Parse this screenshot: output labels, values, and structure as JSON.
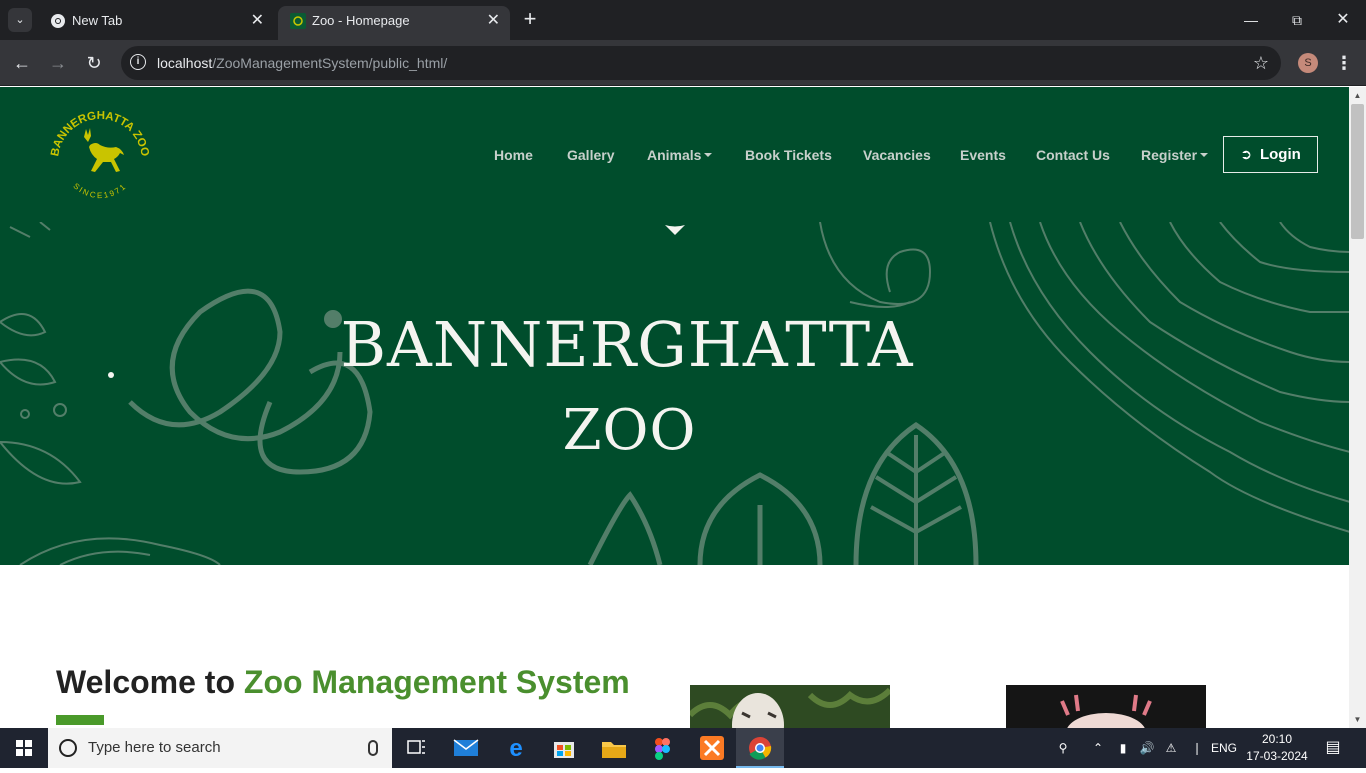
{
  "browser": {
    "tabs": [
      {
        "title": "New Tab",
        "active": false
      },
      {
        "title": "Zoo - Homepage",
        "active": true
      }
    ],
    "url_host": "localhost",
    "url_path": "/ZooManagementSystem/public_html/",
    "profile_initial": "S"
  },
  "site": {
    "logo_text": "BANNERGHATTA ZOO",
    "logo_since": "SINCE1971",
    "nav": [
      "Home",
      "Gallery",
      "Animals",
      "Book Tickets",
      "Vacancies",
      "Events",
      "Contact Us",
      "Register"
    ],
    "login_label": "Login",
    "hero_line1": "BANNERGHATTA",
    "hero_line2": "ZOO",
    "welcome_prefix": "Welcome to",
    "welcome_accent": "Zoo Management System",
    "colors": {
      "header_bg": "#004d2c",
      "accent_green": "#4a8f2e"
    }
  },
  "taskbar": {
    "search_placeholder": "Type here to search",
    "language": "ENG",
    "time": "20:10",
    "date": "17-03-2024"
  }
}
